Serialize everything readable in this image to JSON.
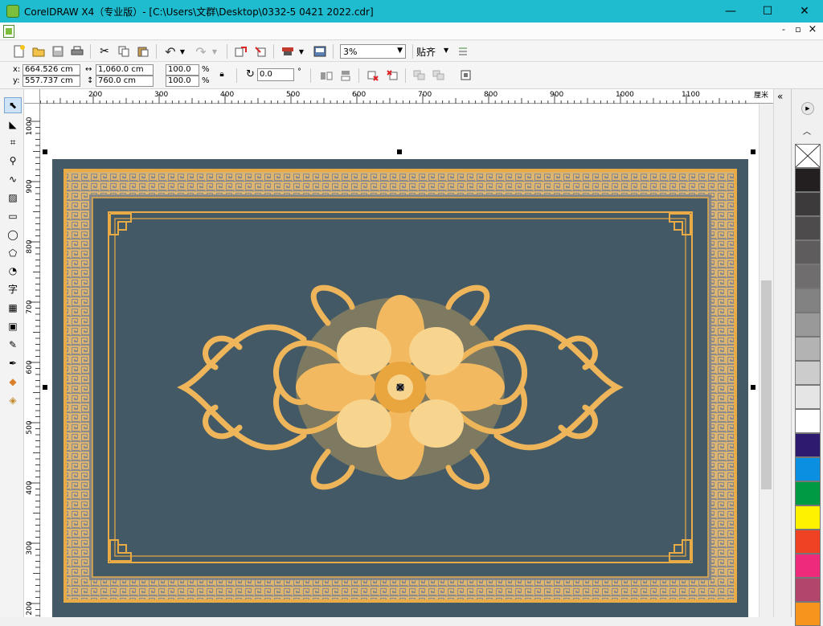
{
  "window": {
    "title": "CorelDRAW X4（专业版）- [C:\\Users\\文群\\Desktop\\0332-5 0421 2022.cdr]",
    "minimize_glyph": "—",
    "maximize_glyph": "☐",
    "close_glyph": "✕",
    "app_icon": "coreldraw-icon",
    "accent": "#1fbcd0"
  },
  "menubar": {
    "doc_icon": "document-icon",
    "restore_glyph": "▫",
    "min_glyph": "-",
    "close_glyph": "×"
  },
  "toolbar": {
    "zoom_value": "3%",
    "snap_label": "贴齐",
    "icons": [
      "new-icon",
      "open-icon",
      "save-icon",
      "print-icon",
      "cut-icon",
      "copy-icon",
      "paste-icon",
      "undo-icon",
      "redo-icon",
      "import-icon",
      "export-icon",
      "app-launcher-icon",
      "welcome-icon"
    ]
  },
  "property_bar": {
    "x_label": "x:",
    "x_value": "664.526 cm",
    "y_label": "y:",
    "y_value": "557.737 cm",
    "width_value": "1,060.0 cm",
    "height_value": "760.0 cm",
    "scale_x": "100.0",
    "scale_y": "100.0",
    "percent": "%",
    "rotation_value": "0.0",
    "degree": "°"
  },
  "hruler": {
    "labels": [
      "200",
      "300",
      "400",
      "500",
      "600",
      "700",
      "800",
      "900",
      "1000",
      "1100"
    ],
    "units": "厘米"
  },
  "vruler": {
    "labels": [
      "1000",
      "900",
      "800",
      "700",
      "600",
      "500",
      "400",
      "300",
      "200"
    ]
  },
  "toolbox": {
    "tools": [
      "pick-tool-icon",
      "shape-tool-icon",
      "crop-tool-icon",
      "zoom-tool-icon",
      "freehand-tool-icon",
      "smart-fill-icon",
      "rectangle-tool-icon",
      "ellipse-tool-icon",
      "polygon-tool-icon",
      "basic-shapes-icon",
      "text-tool-icon",
      "table-tool-icon",
      "interactive-blend-icon",
      "eyedropper-icon",
      "outline-tool-icon",
      "fill-tool-icon",
      "interactive-fill-icon"
    ],
    "text_tool_glyph": "字"
  },
  "palette": {
    "colors": [
      "#231f20",
      "#3c3a3a",
      "#4d4b4b",
      "#5e5c5c",
      "#6f6d6d",
      "#838282",
      "#9a9999",
      "#b3b3b3",
      "#cccccc",
      "#e5e5e5",
      "#ffffff",
      "#2e1a6e",
      "#0b8fe0",
      "#009a44",
      "#fff200",
      "#ef4123",
      "#ed2a7b",
      "#b1456c",
      "#f7941d"
    ]
  },
  "artwork": {
    "background": "#435a66",
    "border_gold": "#e8ab45",
    "inner_panel": "#8a8a8a",
    "ornament_gold": "#f0b85a",
    "ornament_light": "#f7d58f"
  }
}
